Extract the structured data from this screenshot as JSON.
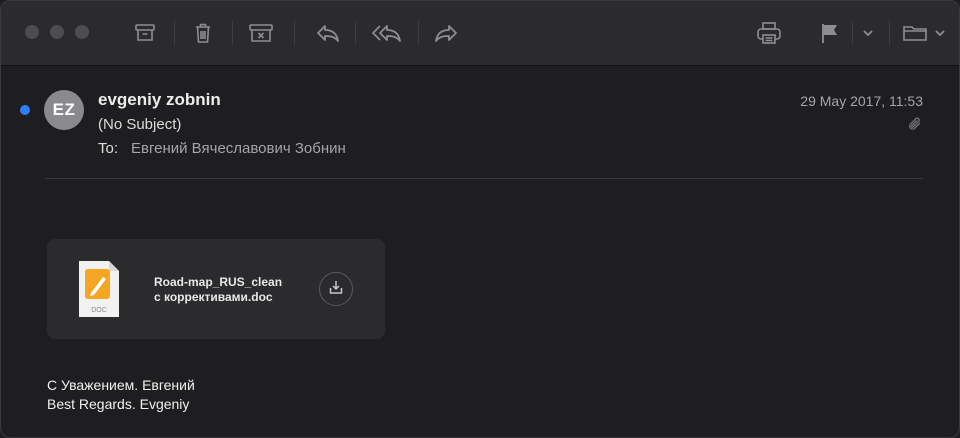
{
  "toolbar": {
    "icons": [
      "archive-icon",
      "trash-icon",
      "junk-icon",
      "reply-icon",
      "reply-all-icon",
      "forward-icon",
      "print-icon",
      "flag-icon",
      "chevron-down-icon",
      "folder-icon",
      "chevron-down-icon"
    ]
  },
  "message": {
    "avatar_initials": "EZ",
    "sender": "evgeniy zobnin",
    "subject": "(No Subject)",
    "to_label": "To:",
    "to_value": "Евгений Вячеславович Зобнин",
    "date": "29 May 2017, 11:53",
    "unread": true,
    "unread_color": "#2f7ff2"
  },
  "attachment": {
    "name_line1": "Road-map_RUS_clean",
    "name_line2": "с коррективами.doc",
    "type_label": "DOC",
    "icon_accent": "#f5a623"
  },
  "body": {
    "line1": "С Уважением. Евгений",
    "line2": "Best Regards. Evgeniy"
  }
}
